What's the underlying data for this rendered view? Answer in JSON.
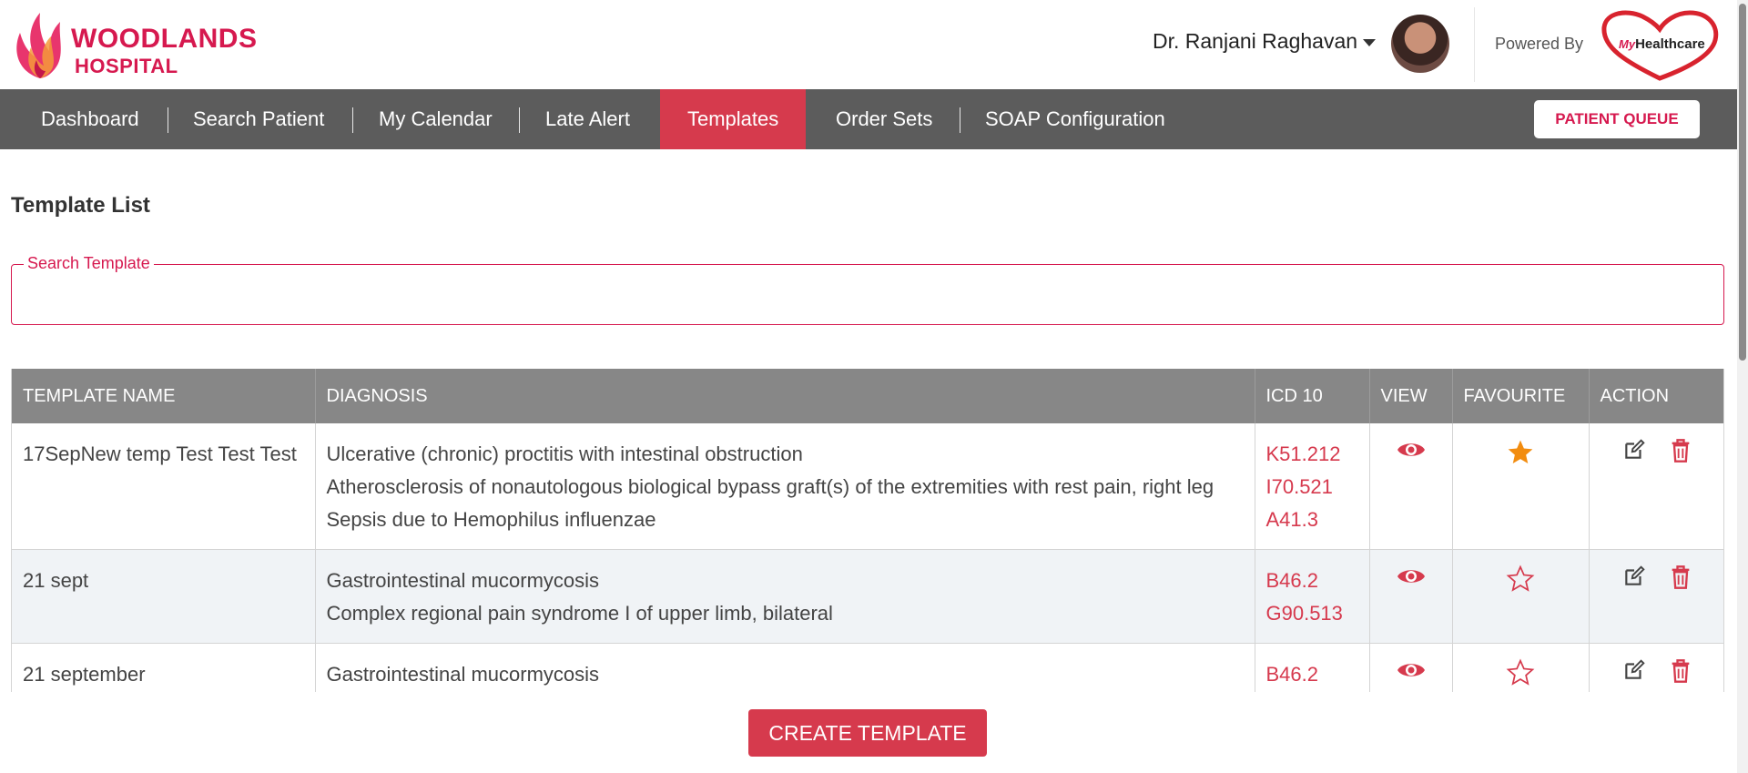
{
  "header": {
    "brand_line1": "WOODLANDS",
    "brand_line2": "HOSPITAL",
    "user_name": "Dr. Ranjani Raghavan",
    "powered_by": "Powered By",
    "partner_logo_my": "My",
    "partner_logo_name": "Healthcare"
  },
  "nav": {
    "items": [
      {
        "label": "Dashboard"
      },
      {
        "label": "Search Patient"
      },
      {
        "label": "My Calendar"
      },
      {
        "label": "Late Alert"
      },
      {
        "label": "Templates",
        "active": true
      },
      {
        "label": "Order Sets"
      },
      {
        "label": "SOAP Configuration"
      }
    ],
    "queue_button": "PATIENT QUEUE"
  },
  "page": {
    "title": "Template List",
    "search": {
      "label": "Search Template",
      "value": ""
    }
  },
  "table": {
    "headers": [
      "TEMPLATE NAME",
      "DIAGNOSIS",
      "ICD 10",
      "VIEW",
      "FAVOURITE",
      "ACTION"
    ],
    "rows": [
      {
        "name": "17SepNew temp Test Test Test",
        "diagnoses": [
          "Ulcerative (chronic) proctitis with intestinal obstruction",
          "Atherosclerosis of nonautologous biological bypass graft(s) of the extremities with rest pain, right leg",
          "Sepsis due to Hemophilus influenzae"
        ],
        "icd": [
          "K51.212",
          "I70.521",
          "A41.3"
        ],
        "favourite": true
      },
      {
        "name": "21 sept",
        "diagnoses": [
          "Gastrointestinal mucormycosis",
          "Complex regional pain syndrome I of upper limb, bilateral"
        ],
        "icd": [
          "B46.2",
          "G90.513"
        ],
        "favourite": false
      },
      {
        "name": "21 september",
        "diagnoses": [
          "Gastrointestinal mucormycosis"
        ],
        "icd": [
          "B46.2"
        ],
        "favourite": false
      }
    ]
  },
  "create_button": "CREATE TEMPLATE",
  "colors": {
    "brand": "#d6194f",
    "accent": "#d63a4d",
    "nav_bg": "#5c5c5c",
    "table_header_bg": "#878787",
    "star_filled": "#f28c0f"
  }
}
